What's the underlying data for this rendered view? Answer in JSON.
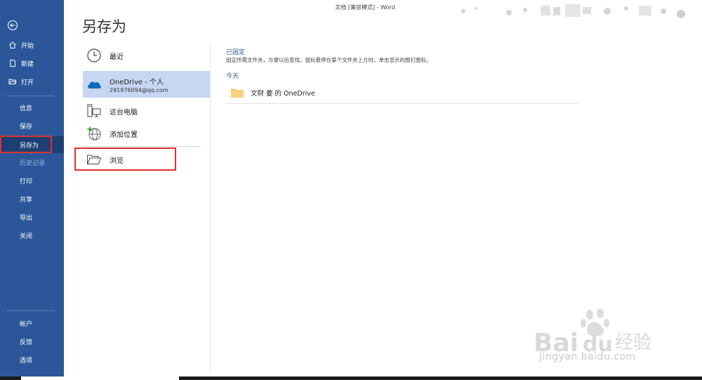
{
  "window": {
    "title": "文档 [兼容模式]  -  Word"
  },
  "sidebar": {
    "top_items": [
      {
        "label": "开始",
        "icon": "home-icon"
      },
      {
        "label": "新建",
        "icon": "new-doc-icon"
      },
      {
        "label": "打开",
        "icon": "open-folder-icon"
      }
    ],
    "mid_items": [
      {
        "label": "信息"
      },
      {
        "label": "保存"
      },
      {
        "label": "另存为"
      },
      {
        "label": "历史记录"
      },
      {
        "label": "打印"
      },
      {
        "label": "共享"
      },
      {
        "label": "导出"
      },
      {
        "label": "关闭"
      }
    ],
    "bottom_items": [
      {
        "label": "帐户"
      },
      {
        "label": "反馈"
      },
      {
        "label": "选项"
      }
    ]
  },
  "page": {
    "title": "另存为"
  },
  "locations": [
    {
      "label": "最近",
      "icon": "clock-icon"
    },
    {
      "label": "OneDrive - 个人",
      "sub": "291976094@qq.com",
      "icon": "onedrive-cloud-icon"
    },
    {
      "label": "这台电脑",
      "icon": "computer-icon"
    },
    {
      "label": "添加位置",
      "icon": "add-location-icon"
    },
    {
      "label": "浏览",
      "icon": "folder-open-icon"
    }
  ],
  "pinned": {
    "title": "已固定",
    "description": "固定所需文件夹，方便以后查找。鼠标悬停在某个文件夹上方时，单击显示的图钉图标。"
  },
  "today": {
    "title": "今天",
    "folders": [
      {
        "label": "文财 姜 的 OneDrive",
        "icon": "folder-icon"
      }
    ]
  },
  "watermark": {
    "brand": "Bai",
    "brand2": "du",
    "cn": "经验",
    "url": "jingyan.baidu.com"
  },
  "colors": {
    "sidebar": "#2b579a",
    "accent": "#2b579a",
    "selected": "#c5d7f3",
    "highlight_box": "#e03030"
  }
}
